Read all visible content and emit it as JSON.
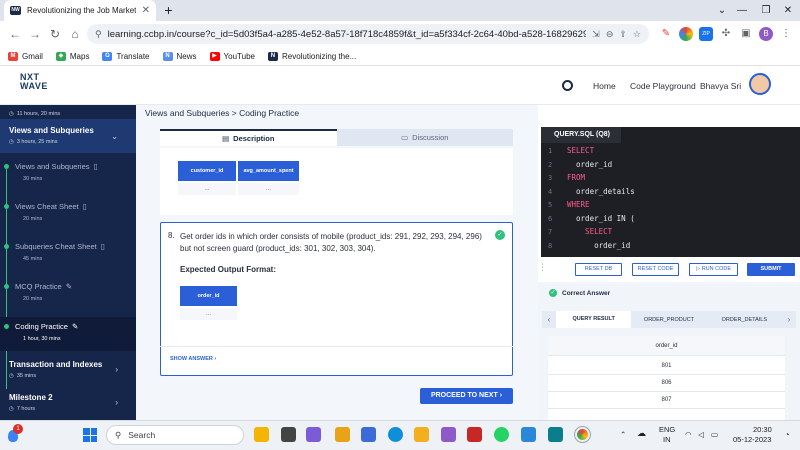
{
  "browser": {
    "tab_title": "Revolutionizing the Job Market |",
    "tab_close": "✕",
    "new_tab": "+",
    "url": "learning.ccbp.in/course?c_id=5d03f5a4-a285-4e52-8a57-18f718c4859f&t_id=a5f334cf-2c64-40bd-a528-16829629c9e...",
    "profile_initial": "B",
    "bookmarks": [
      "Gmail",
      "Maps",
      "Translate",
      "News",
      "YouTube",
      "Revolutionizing the..."
    ]
  },
  "header": {
    "logo_top": "NXT",
    "logo_bottom": "WAVE",
    "home": "Home",
    "playground": "Code Playground",
    "user": "Bhavya Sri"
  },
  "sidebar": {
    "top_duration": "11 hours, 20 mins",
    "section1": {
      "title": "Views and Subqueries",
      "duration": "3 hours, 25 mins"
    },
    "items": [
      {
        "label": "Views and Subqueries",
        "duration": "30 mins"
      },
      {
        "label": "Views Cheat Sheet",
        "duration": "20 mins"
      },
      {
        "label": "Subqueries Cheat Sheet",
        "duration": "45 mins"
      },
      {
        "label": "MCQ Practice",
        "duration": "20 mins"
      },
      {
        "label": "Coding Practice",
        "duration": "1 hour, 30 mins"
      }
    ],
    "section2": {
      "title": "Transaction and Indexes",
      "duration": "35 mins"
    },
    "section3": {
      "title": "Milestone 2",
      "duration": "7 hours"
    }
  },
  "main": {
    "breadcrumb": "Views and Subqueries > Coding Practice",
    "tab_description": "Description",
    "tab_discussion": "Discussion",
    "prev_cols": [
      "customer_id",
      "avg_amount_spent"
    ],
    "prev_cells": [
      "...",
      "..."
    ],
    "q_number": "8.",
    "q_text": "Get order ids in which order consists of mobile (product_ids: 291, 292, 293, 294, 296) but not screen guard (product_ids: 301, 302, 303, 304).",
    "expected": "Expected Output Format:",
    "out_col": "order_id",
    "out_cell": "...",
    "show_answer": "SHOW ANSWER",
    "proceed": "PROCEED TO NEXT"
  },
  "editor": {
    "filename": "QUERY.SQL (Q8)",
    "lines": [
      {
        "n": "1",
        "text": "SELECT",
        "kw": true
      },
      {
        "n": "2",
        "text": "  order_id",
        "kw": false
      },
      {
        "n": "3",
        "text": "FROM",
        "kw": true
      },
      {
        "n": "4",
        "text": "  order_details",
        "kw": false
      },
      {
        "n": "5",
        "text": "WHERE",
        "kw": true
      },
      {
        "n": "6",
        "text": "  order_id IN (",
        "kw": false
      },
      {
        "n": "7",
        "text": "    SELECT",
        "kw": true
      },
      {
        "n": "8",
        "text": "      order_id",
        "kw": false
      }
    ],
    "reset_db": "RESET DB",
    "reset_code": "RESET CODE",
    "run_code": "RUN CODE",
    "submit": "SUBMIT"
  },
  "result": {
    "status": "Correct Answer",
    "tabs": [
      "QUERY RESULT",
      "ORDER_PRODUCT",
      "ORDER_DETAILS"
    ],
    "column": "order_id",
    "rows": [
      "801",
      "806",
      "807"
    ]
  },
  "taskbar": {
    "search": "Search",
    "lang1": "ENG",
    "lang2": "IN",
    "time": "20:30",
    "date": "05-12-2023",
    "weather_badge": "1"
  },
  "colors": {
    "accent": "#2b5fd8",
    "sidebar": "#16254a",
    "success": "#2ec27e"
  }
}
